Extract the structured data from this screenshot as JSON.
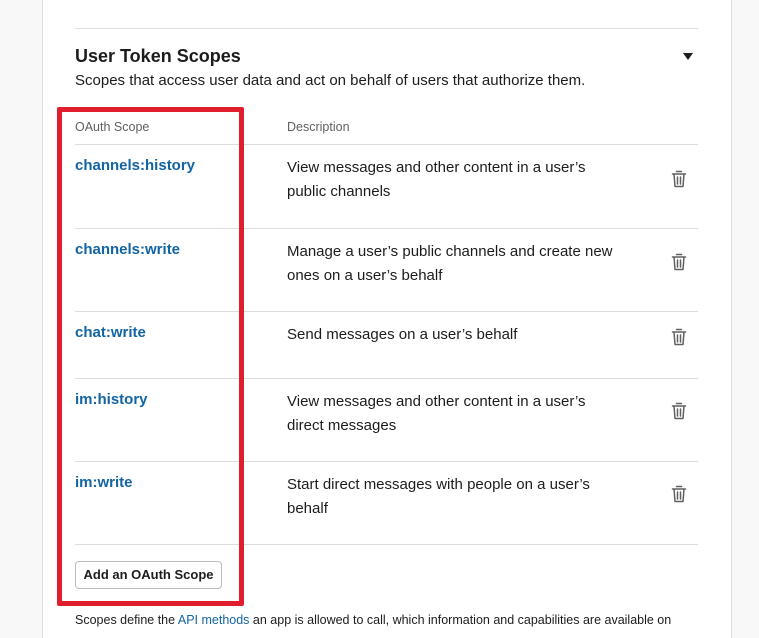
{
  "section": {
    "title": "User Token Scopes",
    "description": "Scopes that access user data and act on behalf of users that authorize them."
  },
  "table": {
    "headers": {
      "scope": "OAuth Scope",
      "description": "Description"
    },
    "rows": [
      {
        "scope": "channels:history",
        "description": "View messages and other content in a user’s public channels"
      },
      {
        "scope": "channels:write",
        "description": "Manage a user’s public channels and create new ones on a user’s behalf"
      },
      {
        "scope": "chat:write",
        "description": "Send messages on a user’s behalf"
      },
      {
        "scope": "im:history",
        "description": "View messages and other content in a user’s direct messages"
      },
      {
        "scope": "im:write",
        "description": "Start direct messages with people on a user’s behalf"
      }
    ]
  },
  "add_button_label": "Add an OAuth Scope",
  "footer": {
    "prefix": "Scopes define the ",
    "link": "API methods",
    "suffix": " an app is allowed to call, which information and capabilities are available on"
  },
  "icons": {
    "row_action": "trash-icon",
    "collapse": "caret-down-icon"
  },
  "colors": {
    "link": "#1264a3",
    "highlight": "#e01e2e",
    "divider": "#dddddd"
  }
}
